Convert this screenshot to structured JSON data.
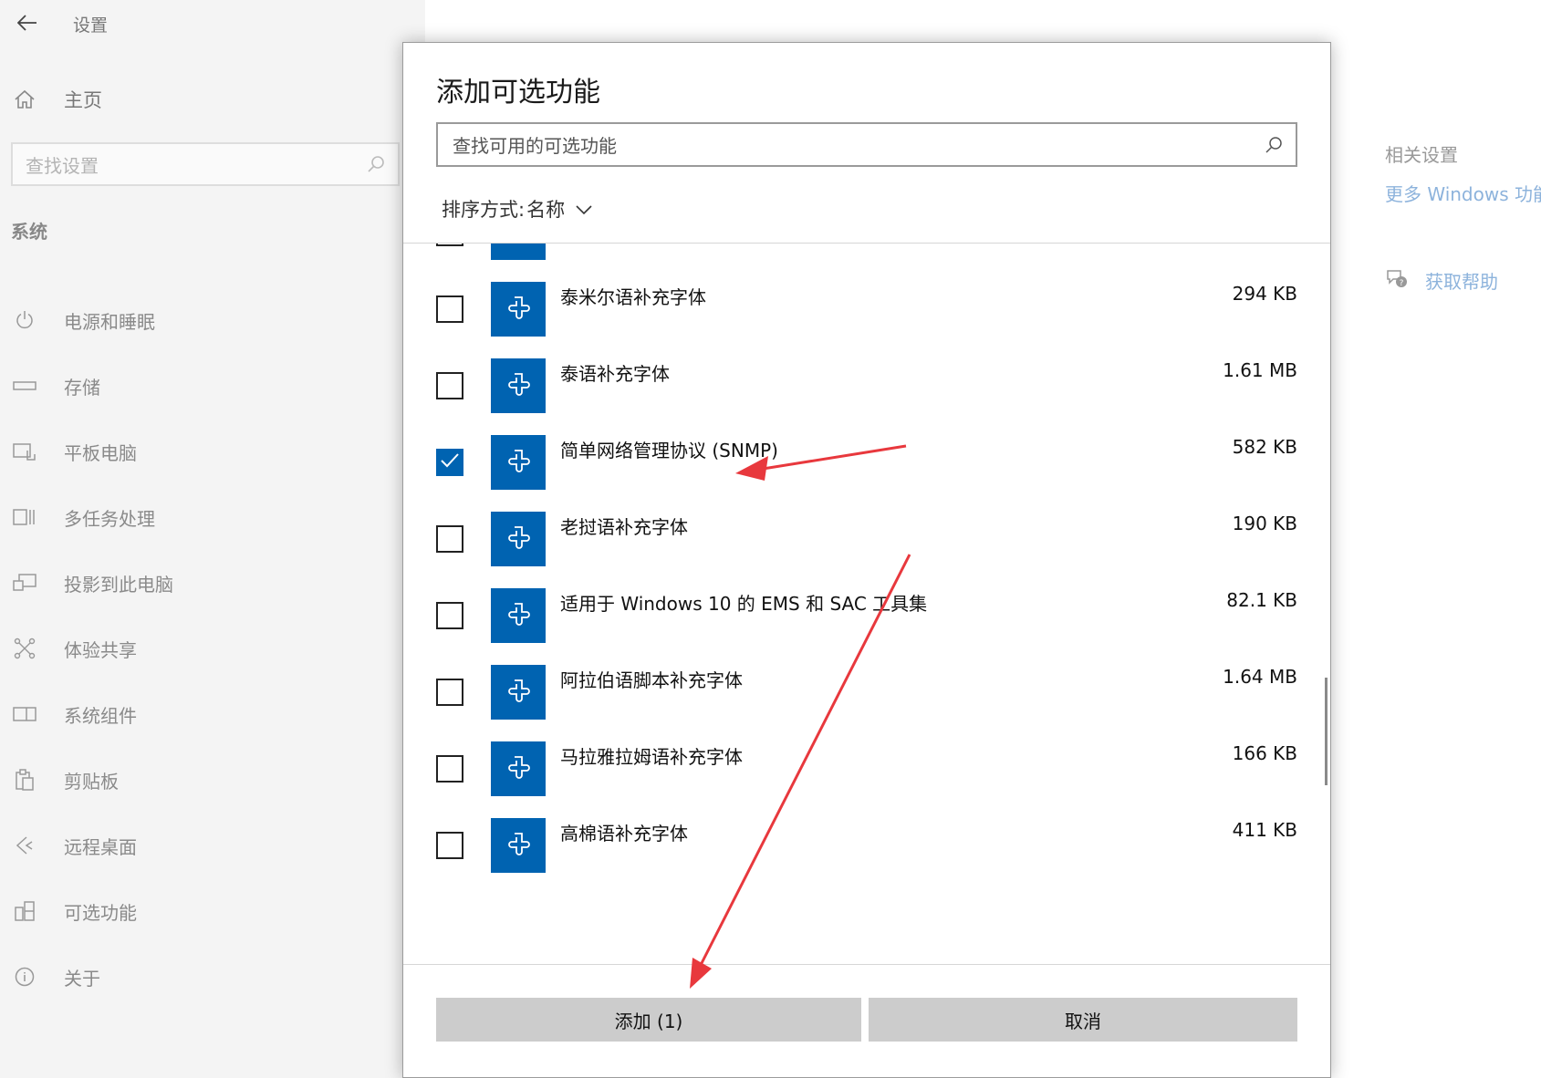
{
  "window": {
    "title": "设置",
    "home_label": "主页",
    "search_placeholder": "查找设置",
    "section_title": "系统"
  },
  "nav_items": [
    {
      "label": "电源和睡眠",
      "icon": "power-icon"
    },
    {
      "label": "存储",
      "icon": "storage-icon"
    },
    {
      "label": "平板电脑",
      "icon": "tablet-icon"
    },
    {
      "label": "多任务处理",
      "icon": "multitask-icon"
    },
    {
      "label": "投影到此电脑",
      "icon": "project-icon"
    },
    {
      "label": "体验共享",
      "icon": "share-icon"
    },
    {
      "label": "系统组件",
      "icon": "components-icon"
    },
    {
      "label": "剪贴板",
      "icon": "clipboard-icon"
    },
    {
      "label": "远程桌面",
      "icon": "remote-desktop-icon"
    },
    {
      "label": "可选功能",
      "icon": "optional-features-icon"
    },
    {
      "label": "关于",
      "icon": "info-icon"
    }
  ],
  "related": {
    "title": "相关设置",
    "link": "更多 Windows 功能",
    "help": "获取帮助"
  },
  "dialog": {
    "title": "添加可选功能",
    "search_placeholder": "查找可用的可选功能",
    "sort_label": "排序方式:",
    "sort_value": "名称",
    "features": [
      {
        "name": "",
        "size": "",
        "checked": false
      },
      {
        "name": "泰米尔语补充字体",
        "size": "294 KB",
        "checked": false
      },
      {
        "name": "泰语补充字体",
        "size": "1.61 MB",
        "checked": false
      },
      {
        "name": "简单网络管理协议 (SNMP)",
        "size": "582 KB",
        "checked": true
      },
      {
        "name": "老挝语补充字体",
        "size": "190 KB",
        "checked": false
      },
      {
        "name": "适用于 Windows 10 的 EMS 和 SAC 工具集",
        "size": "82.1 KB",
        "checked": false
      },
      {
        "name": "阿拉伯语脚本补充字体",
        "size": "1.64 MB",
        "checked": false
      },
      {
        "name": "马拉雅拉姆语补充字体",
        "size": "166 KB",
        "checked": false
      },
      {
        "name": "高棉语补充字体",
        "size": "411 KB",
        "checked": false
      }
    ],
    "add_button": "添加 (1)",
    "cancel_button": "取消"
  },
  "colors": {
    "accent": "#0063b1",
    "annotation": "#e8383d"
  }
}
